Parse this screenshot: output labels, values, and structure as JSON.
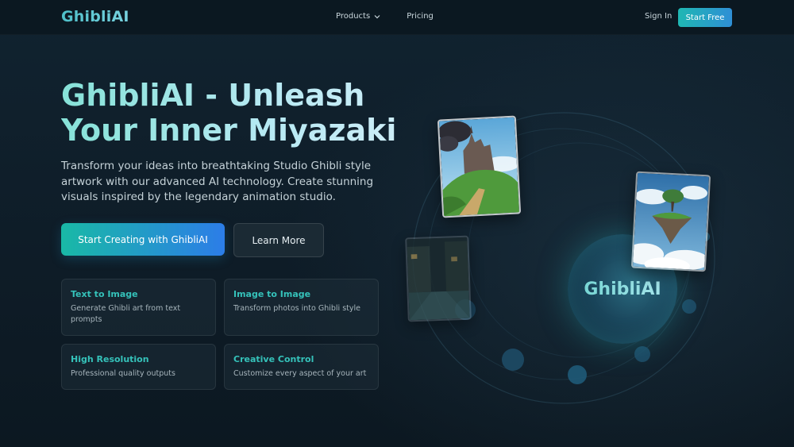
{
  "nav": {
    "logo": "GhibliAI",
    "links": [
      {
        "label": "Products",
        "has_dropdown": true
      },
      {
        "label": "Pricing",
        "has_dropdown": false
      }
    ],
    "sign_in": "Sign In",
    "start_free": "Start Free"
  },
  "hero": {
    "title": "GhibliAI - Unleash Your Inner Miyazaki",
    "subtitle": "Transform your ideas into breathtaking Studio Ghibli style artwork with our advanced AI technology. Create stunning visuals inspired by the legendary animation studio.",
    "primary_cta": "Start Creating with GhibliAI",
    "secondary_cta": "Learn More"
  },
  "features": [
    {
      "title": "Text to Image",
      "description": "Generate Ghibli art from text prompts"
    },
    {
      "title": "Image to Image",
      "description": "Transform photos into Ghibli style"
    },
    {
      "title": "High Resolution",
      "description": "Professional quality outputs"
    },
    {
      "title": "Creative Control",
      "description": "Customize every aspect of your art"
    }
  ],
  "showcase": {
    "orb_label": "GhibliAI",
    "images": [
      "castle-on-hill-image",
      "floating-island-image",
      "night-street-image"
    ]
  },
  "colors": {
    "background": "#0e1b25",
    "accent_teal": "#35c2ba",
    "accent_blue": "#2c7de8",
    "nav_bg": "#0b1821"
  }
}
